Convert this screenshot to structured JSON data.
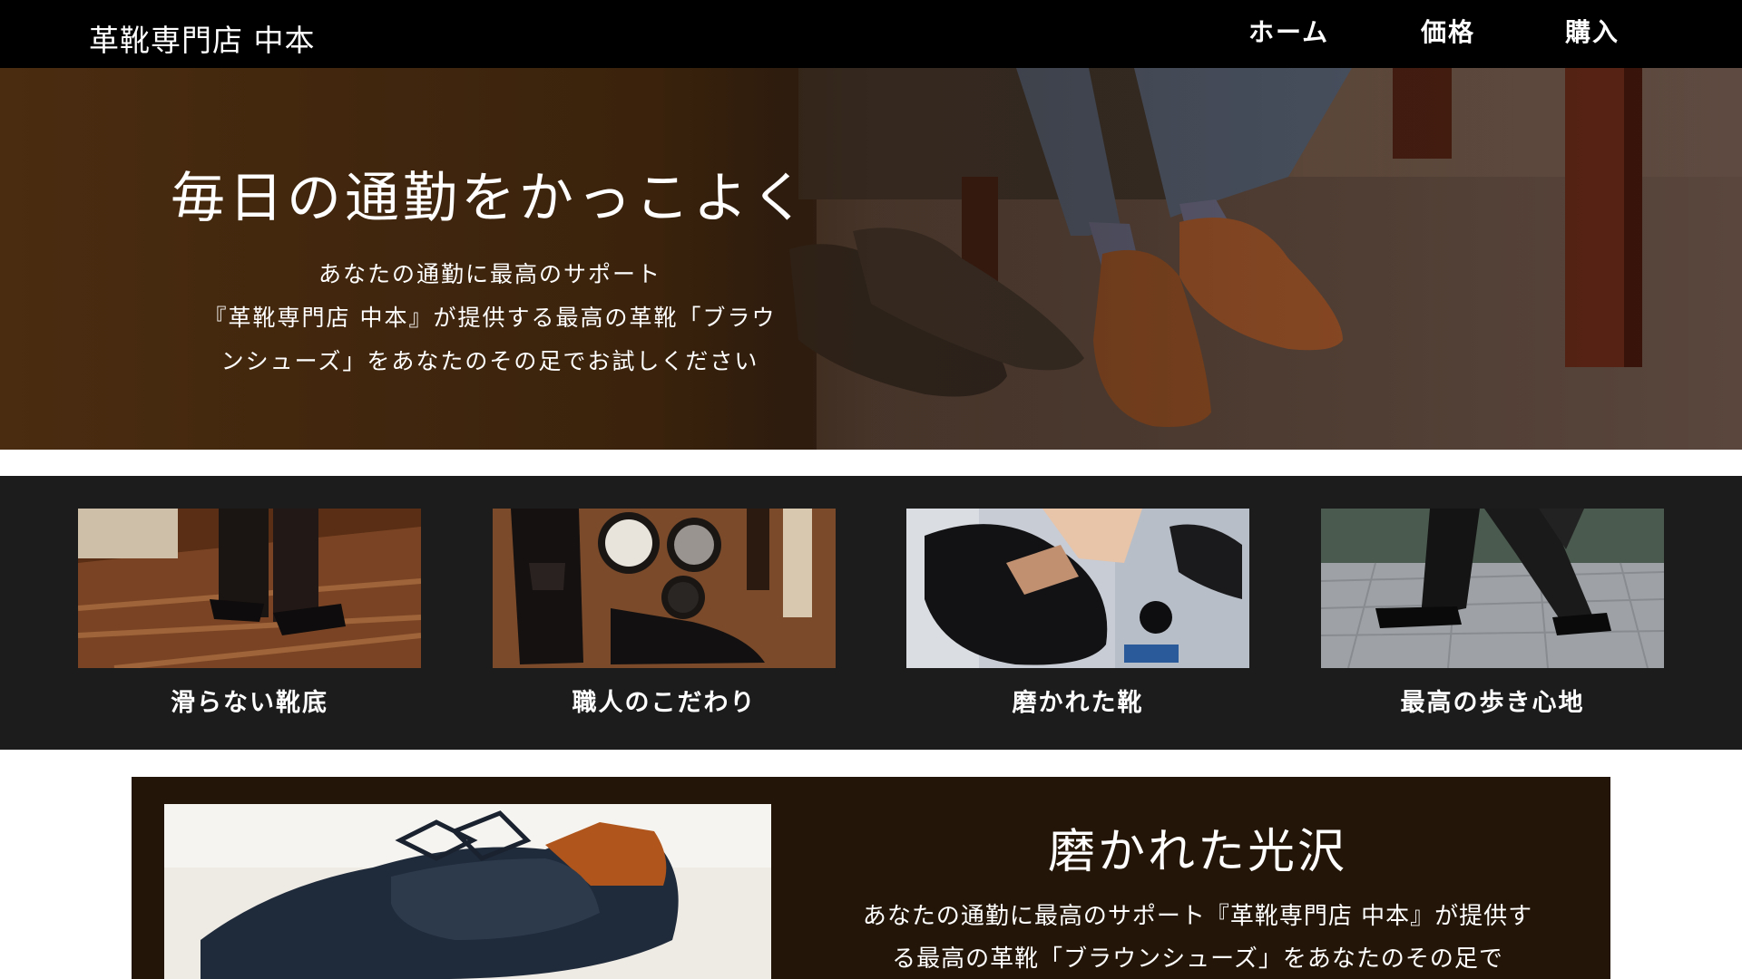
{
  "header": {
    "brand": "革靴専門店 中本",
    "nav": [
      "ホーム",
      "価格",
      "購入"
    ]
  },
  "hero": {
    "title": "毎日の通勤をかっこよく",
    "subtitle_line1": "あなたの通勤に最高のサポート",
    "subtitle_line2": "『革靴専門店 中本』が提供する最高の革靴「ブラウ",
    "subtitle_line3": "ンシューズ」をあなたのその足でお試しください"
  },
  "features": [
    {
      "caption": "滑らない靴底",
      "image": "shoes-on-wooden-floor"
    },
    {
      "caption": "職人のこだわり",
      "image": "shoe-care-kit"
    },
    {
      "caption": "磨かれた靴",
      "image": "polishing-shoe"
    },
    {
      "caption": "最高の歩き心地",
      "image": "walking-businessman"
    }
  ],
  "showcase": {
    "title": "磨かれた光沢",
    "body": "あなたの通勤に最高のサポート『革靴専門店 中本』が提供する最高の革靴「ブラウンシューズ」をあなたのその足で",
    "image": "polished-black-shoes"
  },
  "colors": {
    "header_bg": "#000000",
    "features_bg": "#1c1c1c",
    "showcase_bg": "#231608",
    "text": "#ffffff"
  }
}
